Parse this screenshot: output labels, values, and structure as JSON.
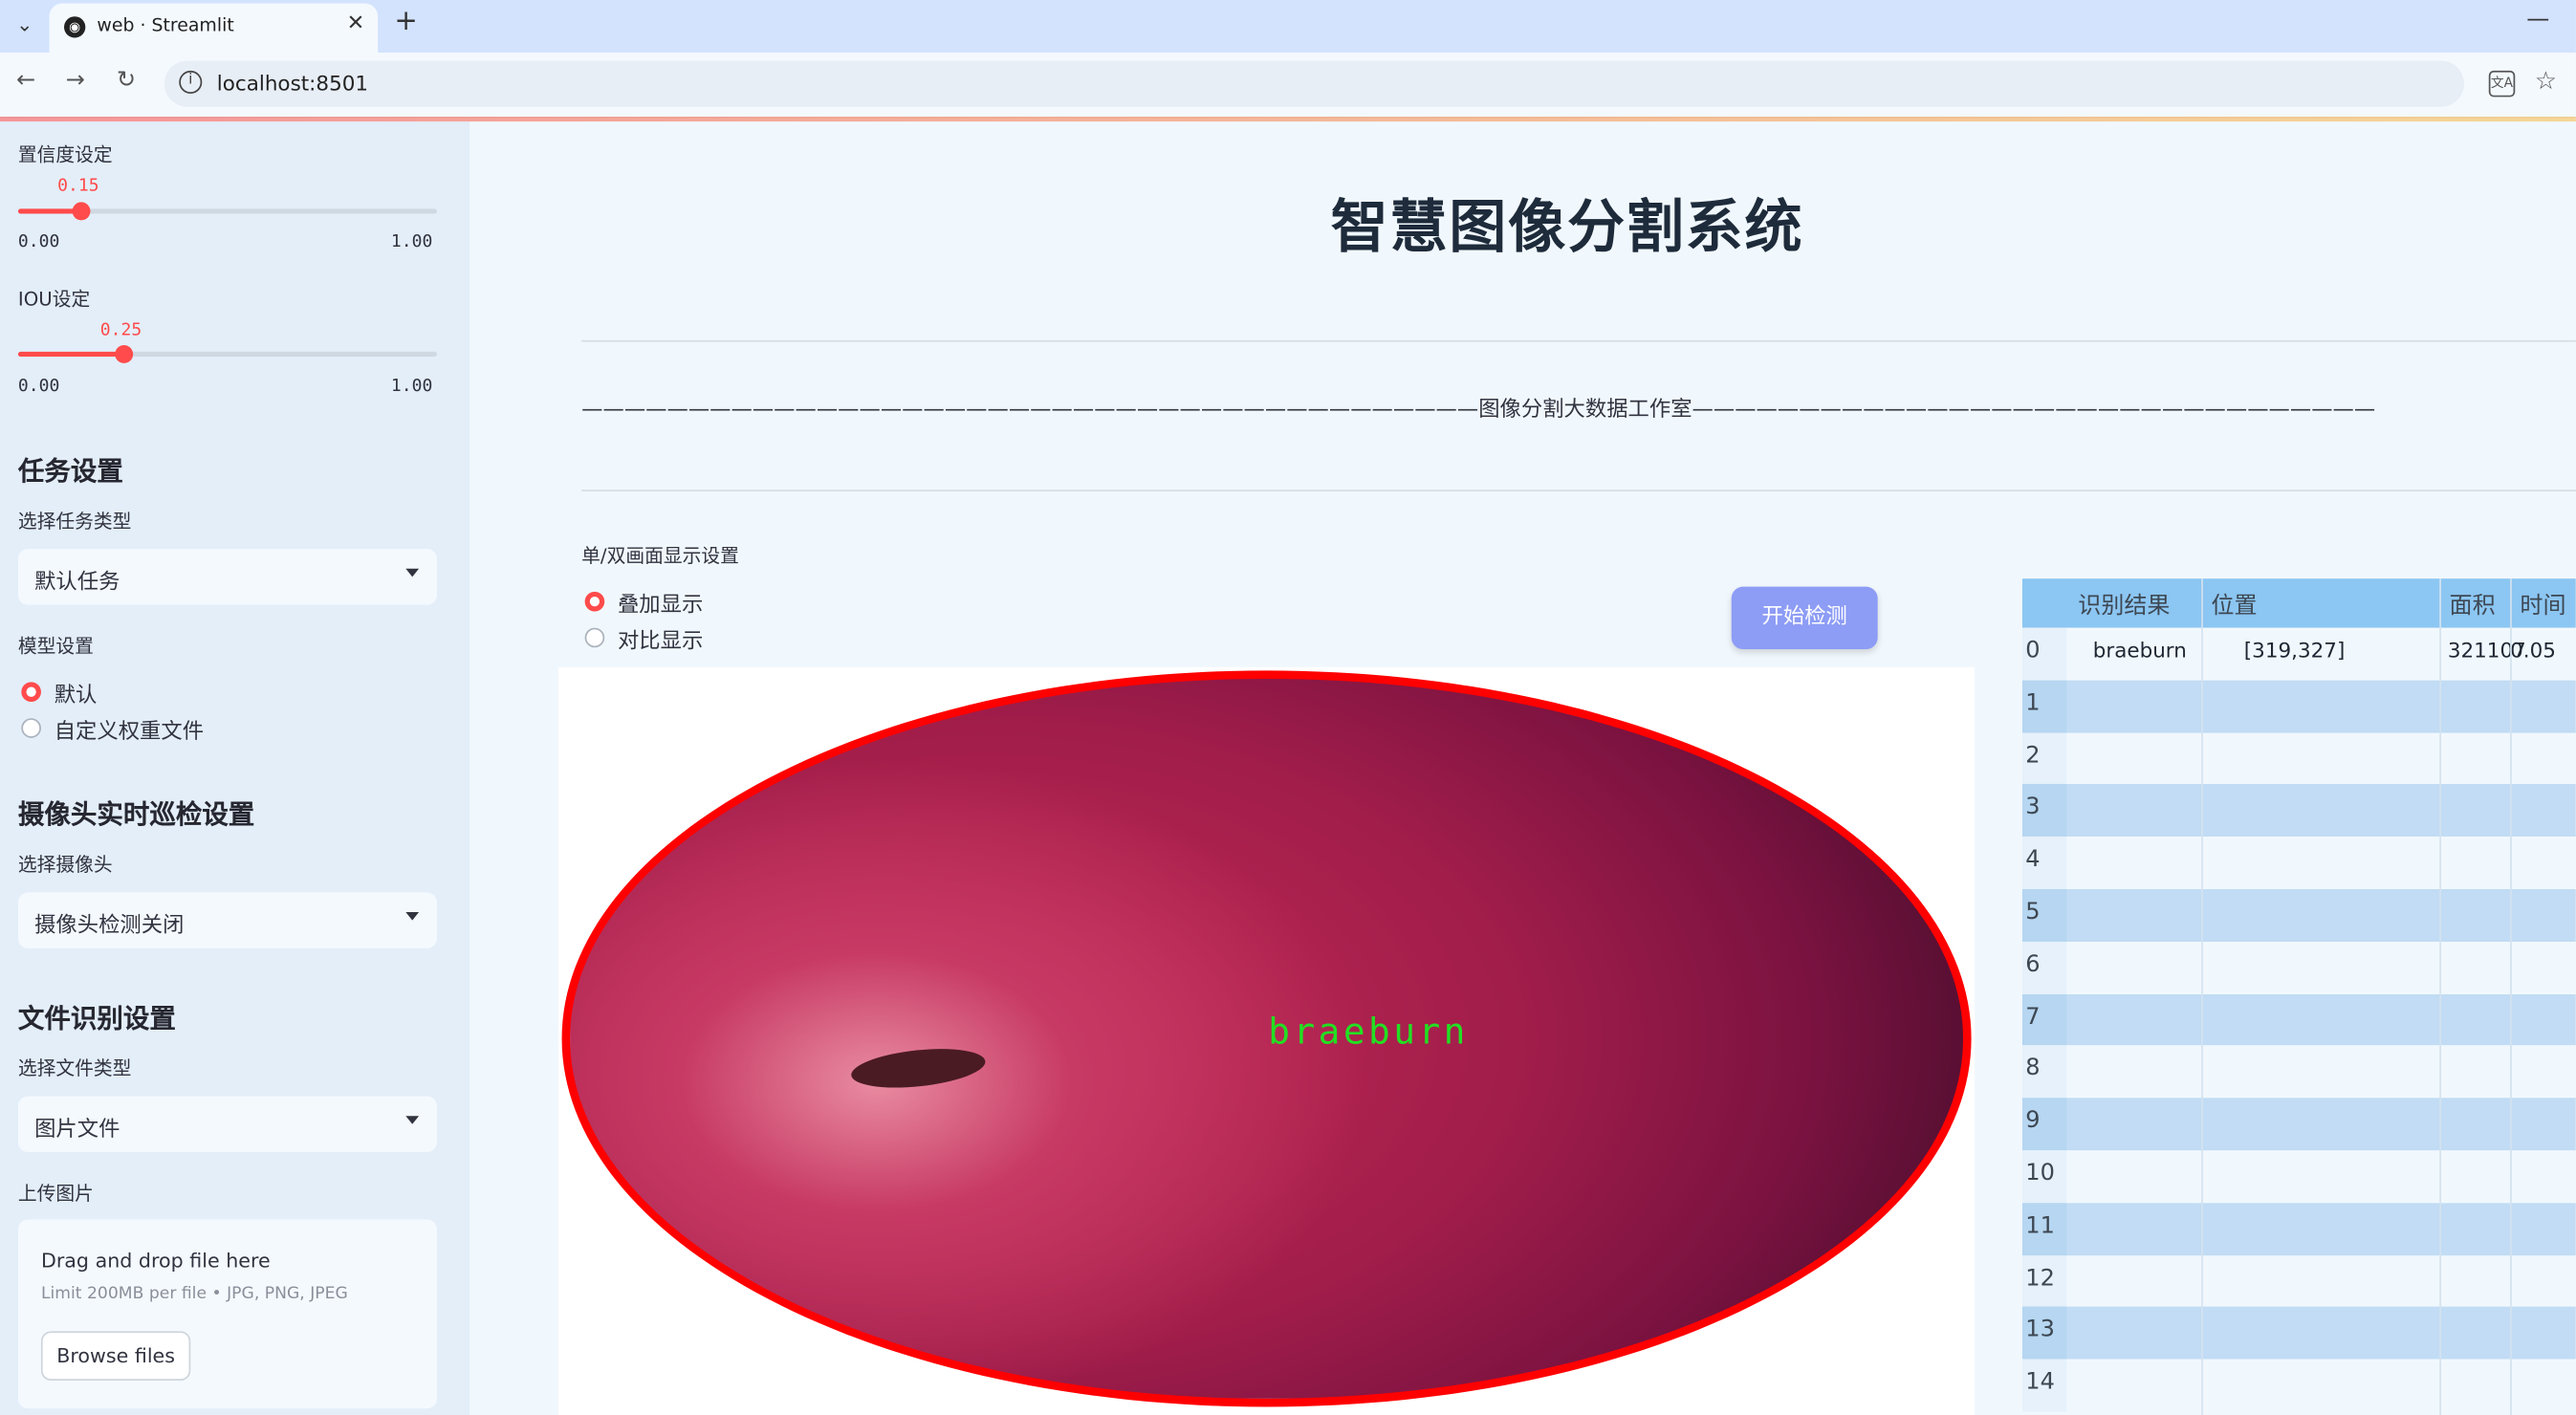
{
  "browser": {
    "tab_title": "web · Streamlit",
    "url": "localhost:8501"
  },
  "sidebar": {
    "confidence": {
      "label": "置信度设定",
      "value": "0.15",
      "min": "0.00",
      "max": "1.00",
      "fraction": 0.15
    },
    "iou": {
      "label": "IOU设定",
      "value": "0.25",
      "min": "0.00",
      "max": "1.00",
      "fraction": 0.25
    },
    "task": {
      "heading": "任务设置",
      "select_label": "选择任务类型",
      "selected": "默认任务"
    },
    "model": {
      "label": "模型设置",
      "options": [
        "默认",
        "自定义权重文件"
      ],
      "selected_index": 0
    },
    "camera": {
      "heading": "摄像头实时巡检设置",
      "select_label": "选择摄像头",
      "selected": "摄像头检测关闭"
    },
    "file": {
      "heading": "文件识别设置",
      "select_label": "选择文件类型",
      "selected": "图片文件"
    },
    "upload": {
      "label": "上传图片",
      "drop_text": "Drag and drop file here",
      "limit_text": "Limit 200MB per file • JPG, PNG, JPEG",
      "browse_label": "Browse files"
    }
  },
  "main": {
    "title": "智慧图像分割系统",
    "subtitle": "——————————————————————————————————————————图像分割大数据工作室——————————————————————————————————————————————",
    "display_mode": {
      "label": "单/双画面显示设置",
      "options": [
        "叠加显示",
        "对比显示"
      ],
      "selected_index": 0
    },
    "start_button": "开始检测",
    "detection_label": "braeburn",
    "table": {
      "headers": [
        "识别结果",
        "位置",
        "面积",
        "时间"
      ],
      "rows": [
        {
          "index": "0",
          "result": "braeburn",
          "position": "[319,327]",
          "area": "321107",
          "time": "0.05"
        },
        {
          "index": "1"
        },
        {
          "index": "2"
        },
        {
          "index": "3"
        },
        {
          "index": "4"
        },
        {
          "index": "5"
        },
        {
          "index": "6"
        },
        {
          "index": "7"
        },
        {
          "index": "8"
        },
        {
          "index": "9"
        },
        {
          "index": "10"
        },
        {
          "index": "11"
        },
        {
          "index": "12"
        },
        {
          "index": "13"
        },
        {
          "index": "14"
        }
      ]
    }
  },
  "colors": {
    "accent": "#ff4b4b",
    "button": "#8d9cf5",
    "table_header": "#8cc6f2",
    "mask_outline": "#ff0000",
    "label_green": "#22e022"
  }
}
